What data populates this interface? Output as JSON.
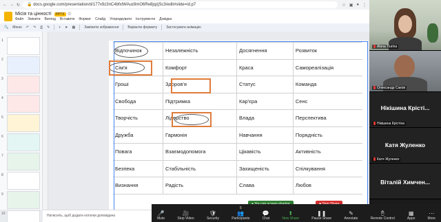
{
  "browser": {
    "url": "docs.google.com/presentation/d/177x9z3nC4bfxtWAuz8mO6Re8jqzjSc3/edit#slide=id.p7"
  },
  "document": {
    "title": "Місія та цінності",
    "badge": "PPTX",
    "menu": [
      "Файл",
      "Змінити",
      "Вигляд",
      "Вставити",
      "Формат",
      "Слайд",
      "Упорядкувати",
      "Інструменти",
      "Довідка"
    ]
  },
  "toolbar": {
    "menu_label": "Меню",
    "replace_image": "Замінити зображення",
    "format_options": "Варіанти формату",
    "animation": "Застосувати анімацію"
  },
  "slides": {
    "numbers": [
      "1",
      "2",
      "3",
      "4",
      "5",
      "6",
      "7",
      "8",
      "9",
      "10"
    ]
  },
  "table": {
    "rows": [
      [
        "Відпочинок",
        "Незалежність",
        "Досягнення",
        "Розвиток"
      ],
      [
        "Сім'я",
        "Комфорт",
        "Краса",
        "Самореалізація"
      ],
      [
        "Гроші",
        "Здоров'я",
        "Статус",
        "Команда"
      ],
      [
        "Свобода",
        "Підтримка",
        "Кар'єра",
        "Сенс"
      ],
      [
        "Творчість",
        "Лідерство",
        "Влада",
        "Перспектива"
      ],
      [
        "Дружба",
        "Гармонія",
        "Навчання",
        "Порядність"
      ],
      [
        "Повага",
        "Взаємодопомога",
        "Цікавість",
        "Активність"
      ],
      [
        "Безпека",
        "Стабільність",
        "Захищеність",
        "Спілкування"
      ],
      [
        "Визнання",
        "Радість",
        "Слава",
        "Любов"
      ]
    ]
  },
  "notes": {
    "placeholder": "Натисніть, щоб додати нотатки доповідача"
  },
  "participants": [
    {
      "name": "Alona Tiurina",
      "type": "video"
    },
    {
      "name": "Олександр Саков",
      "type": "video"
    },
    {
      "display": "Нікішина Крісті...",
      "name": "Нікішина Крістіна",
      "type": "name"
    },
    {
      "display": "Катя Жуленко",
      "name": "Катя Жуленко",
      "type": "name"
    },
    {
      "display": "Віталій Химчен...",
      "name": "",
      "type": "name"
    }
  ],
  "zoom": {
    "sharing_status": "You are screen sharing",
    "stop_share": "Stop Share",
    "controls": [
      "Mute",
      "Stop Video",
      "Security",
      "Participants",
      "Chat",
      "New Share",
      "Pause Share",
      "Annotate",
      "Remote Control",
      "Apps",
      "More"
    ],
    "participants_count": "5",
    "colors": {
      "share_green": "#2e7d32",
      "stop_red": "#d32f2f",
      "highlight_orange": "#e07b39",
      "selection_blue": "#4285f4"
    }
  }
}
